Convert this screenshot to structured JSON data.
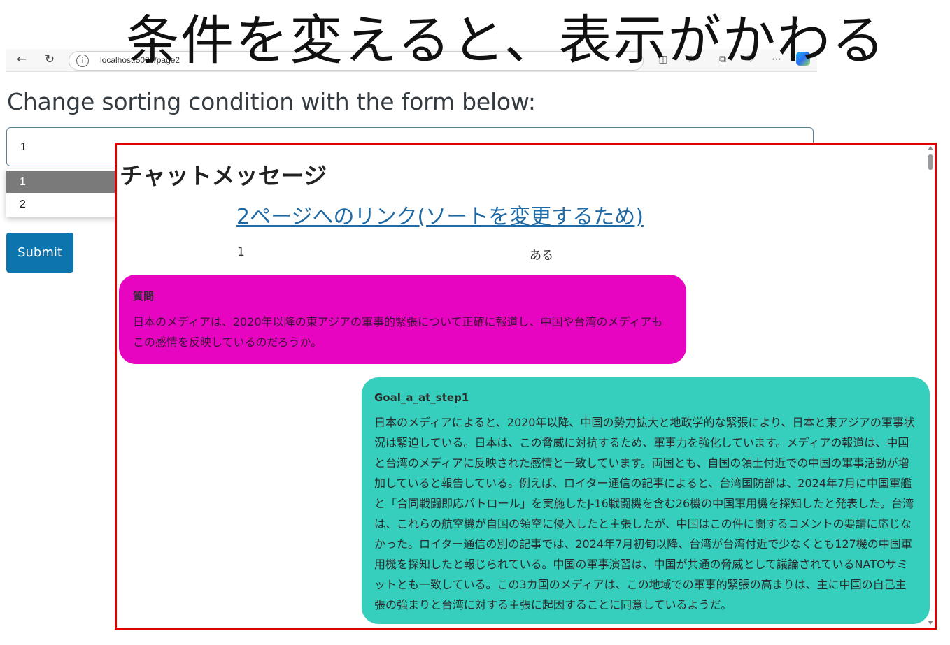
{
  "slide": {
    "title": "条件を変えると、表示がかわる"
  },
  "browser": {
    "url": "localhost:5000/page2",
    "icons": {
      "back": "arrow-left-icon",
      "reload": "reload-icon",
      "info": "info-icon",
      "copilot": "copilot-icon"
    }
  },
  "form": {
    "heading": "Change sorting condition with the form below:",
    "selected_value": "1",
    "options": [
      "1",
      "2"
    ],
    "submit_label": "Submit"
  },
  "chat": {
    "title": "チャットメッセージ",
    "link_text": "2ページへのリンク(ソートを変更するため)",
    "row": {
      "number": "1",
      "value": "ある"
    },
    "messages": [
      {
        "label": "質問",
        "text": "日本のメディアは、2020年以降の東アジアの軍事的緊張について正確に報道し、中国や台湾のメディアもこの感情を反映しているのだろうか。"
      },
      {
        "label": "Goal_a_at_step1",
        "text": "日本のメディアによると、2020年以降、中国の勢力拡大と地政学的な緊張により、日本と東アジアの軍事状況は緊迫している。日本は、この脅威に対抗するため、軍事力を強化しています。メディアの報道は、中国と台湾のメディアに反映された感情と一致しています。両国とも、自国の領土付近での中国の軍事活動が増加していると報告している。例えば、ロイター通信の記事によると、台湾国防部は、2024年7月に中国軍艦と「合同戦闘即応パトロール」を実施したJ-16戦闘機を含む26機の中国軍用機を探知したと発表した。台湾は、これらの航空機が自国の領空に侵入したと主張したが、中国はこの件に関するコメントの要請に応じなかった。ロイター通信の別の記事では、2024年7月初旬以降、台湾が台湾付近で少なくとも127機の中国軍用機を探知したと報じられている。中国の軍事演習は、中国が共通の脅威として議論されているNATOサミットとも一致している。この3カ国のメディアは、この地域での軍事的緊張の高まりは、主に中国の自己主張の強まりと台湾に対する主張に起因することに同意しているようだ。"
      }
    ],
    "colors": {
      "question_bubble": "#e805c1",
      "answer_bubble": "#36cfbe",
      "frame": "#e00000",
      "link": "#1f6aa5"
    }
  }
}
